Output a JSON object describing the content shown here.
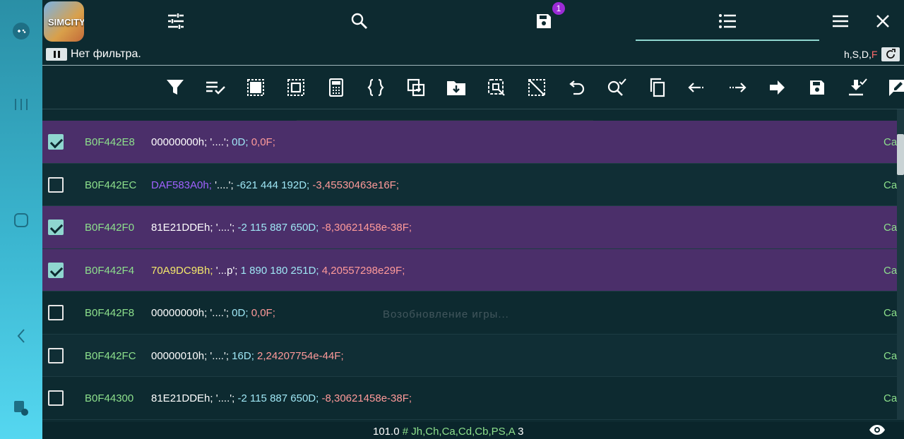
{
  "app": {
    "icon_label": "SIMCITY"
  },
  "topbar": {
    "tabs": [
      {
        "name": "settings",
        "icon": "tune-icon"
      },
      {
        "name": "search",
        "icon": "search-icon"
      },
      {
        "name": "saved",
        "icon": "save-icon",
        "badge": "1"
      },
      {
        "name": "list",
        "icon": "list-icon",
        "active": true
      },
      {
        "name": "menu",
        "icon": "menu-icon"
      },
      {
        "name": "close",
        "icon": "close-icon"
      }
    ]
  },
  "filter": {
    "text": "Нет фильтра.",
    "types_prefix": "h,S,D,",
    "types_last": "F"
  },
  "background": {
    "logo": "SIMCITY",
    "loading": "Возобновление игры..."
  },
  "rows": [
    {
      "checked": true,
      "addr": "B0F442E8",
      "hex": "00000000h;",
      "hex_color": "white",
      "str": "'....';",
      "dec": "0D;",
      "flt": "0,0F;",
      "type": "Ca"
    },
    {
      "checked": false,
      "addr": "B0F442EC",
      "hex": "DAF583A0h;",
      "hex_color": "purple",
      "str": "'....';",
      "dec": "-621 444 192D;",
      "flt": "-3,45530463e16F;",
      "type": "Ca"
    },
    {
      "checked": true,
      "addr": "B0F442F0",
      "hex": "81E21DDEh;",
      "hex_color": "white",
      "str": "'....';",
      "dec": "-2 115 887 650D;",
      "flt": "-8,30621458e-38F;",
      "type": "Ca"
    },
    {
      "checked": true,
      "addr": "B0F442F4",
      "hex": "70A9DC9Bh;",
      "hex_color": "yellow",
      "str": "'...p';",
      "dec": "1 890 180 251D;",
      "flt": "4,20557298e29F;",
      "type": "Ca"
    },
    {
      "checked": false,
      "addr": "B0F442F8",
      "hex": "00000000h;",
      "hex_color": "white",
      "str": "'....';",
      "dec": "0D;",
      "flt": "0,0F;",
      "type": "Ca"
    },
    {
      "checked": false,
      "addr": "B0F442FC",
      "hex": "00000010h;",
      "hex_color": "white",
      "str": "'....';",
      "dec": "16D;",
      "flt": "2,24207754e-44F;",
      "type": "Ca"
    },
    {
      "checked": false,
      "addr": "B0F44300",
      "hex": "81E21DDEh;",
      "hex_color": "white",
      "str": "'....';",
      "dec": "-2 115 887 650D;",
      "flt": "-8,30621458e-38F;",
      "type": "Ca"
    }
  ],
  "status": {
    "version": "101.0",
    "hash": "#",
    "regions": "Jh,Ch,Ca,Cd,Cb,PS,A",
    "count": "3"
  },
  "colors": {
    "accent": "#8fd6cf",
    "address": "#8de08c",
    "selected_row": "#4b2f6a",
    "badge": "#9b2bd6"
  }
}
